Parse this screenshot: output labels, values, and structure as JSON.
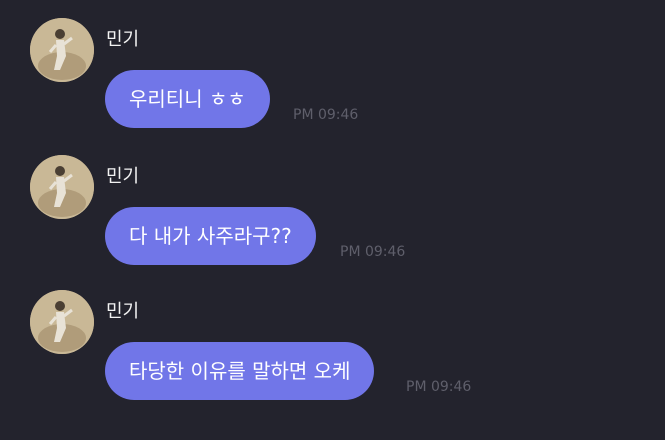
{
  "messages": [
    {
      "sender": "민기",
      "text": "우리티니 ㅎㅎ",
      "time": "PM 09:46"
    },
    {
      "sender": "민기",
      "text": "다 내가 사주라구??",
      "time": "PM 09:46"
    },
    {
      "sender": "민기",
      "text": "타당한 이유를 말하면 오케",
      "time": "PM 09:46"
    }
  ],
  "colors": {
    "background": "#23232d",
    "bubble": "#7176e8",
    "timestamp": "#5f5f6b"
  }
}
